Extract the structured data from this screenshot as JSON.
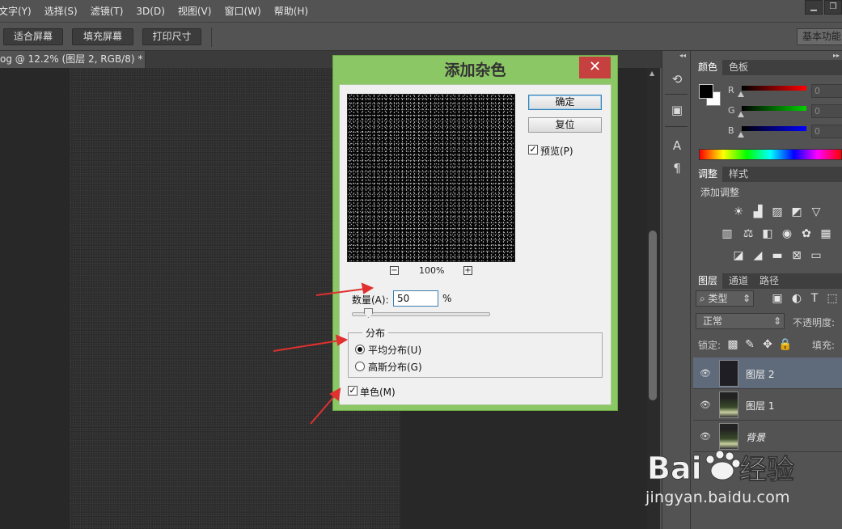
{
  "menubar": {
    "items": [
      "文字(Y)",
      "选择(S)",
      "滤镜(T)",
      "3D(D)",
      "视图(V)",
      "窗口(W)",
      "帮助(H)"
    ]
  },
  "optionsbar": {
    "fit_screen": "适合屏幕",
    "fill_screen": "填充屏幕",
    "print_size": "打印尺寸",
    "workspace": "基本功能"
  },
  "document": {
    "tab_title": "og @ 12.2% (图层 2, RGB/8) *"
  },
  "color_panel": {
    "tabs": [
      "颜色",
      "色板"
    ],
    "channels": [
      {
        "label": "R",
        "value": "0",
        "color": "#ff0000"
      },
      {
        "label": "G",
        "value": "0",
        "color": "#00c000"
      },
      {
        "label": "B",
        "value": "0",
        "color": "#0000ff"
      }
    ]
  },
  "adjust_panel": {
    "tabs": [
      "调整",
      "样式"
    ],
    "heading": "添加调整"
  },
  "layers_panel": {
    "tabs": [
      "图层",
      "通道",
      "路径"
    ],
    "filter_kind": "类型",
    "blend_mode": "正常",
    "opacity_label": "不透明度:",
    "lock_label": "锁定:",
    "fill_label": "填充:",
    "layers": [
      {
        "name": "图层 2",
        "selected": true
      },
      {
        "name": "图层 1",
        "selected": false
      },
      {
        "name": "背景",
        "selected": false
      }
    ]
  },
  "dialog": {
    "title": "添加杂色",
    "ok": "确定",
    "reset": "复位",
    "preview_label": "预览(P)",
    "preview_checked": true,
    "zoom": "100%",
    "amount_label": "数量(A):",
    "amount_value": "50",
    "percent": "%",
    "distribution_label": "分布",
    "uniform": "平均分布(U)",
    "gaussian": "高斯分布(G)",
    "selected_distribution": "uniform",
    "monochromatic": "单色(M)",
    "monochromatic_checked": true
  },
  "watermark": {
    "text": "jingyan.baidu.com",
    "logo_text": "Bai经验"
  },
  "colors": {
    "accent_green": "#8cc765",
    "close_red": "#c64040",
    "annotation_red": "#e03030",
    "panel_bg": "#535353"
  }
}
